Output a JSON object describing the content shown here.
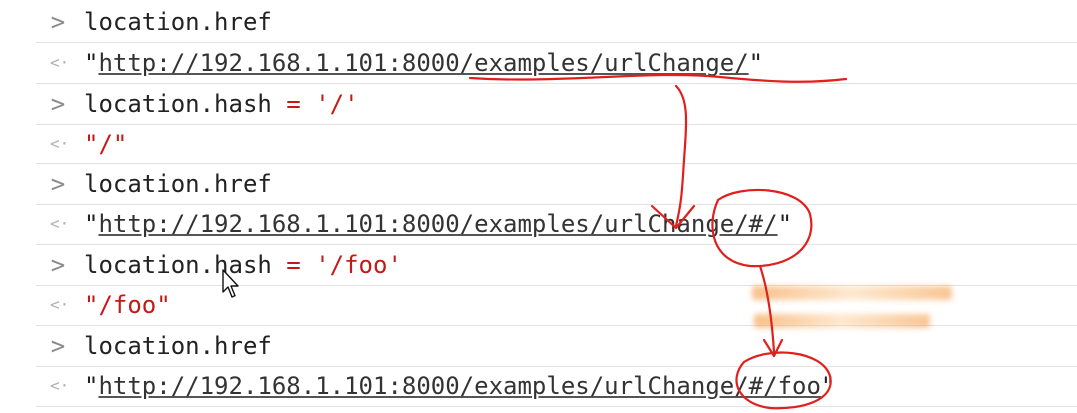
{
  "console": {
    "entries": [
      {
        "type": "input",
        "prompt": ">",
        "text": "location.href"
      },
      {
        "type": "output",
        "prompt": "<·",
        "quote_open": "\"",
        "url": "http://192.168.1.101:8000/examples/urlChange/",
        "quote_close": "\""
      },
      {
        "type": "input",
        "prompt": ">",
        "code": "location.hash",
        "operator": "=",
        "string": "'/'"
      },
      {
        "type": "output",
        "prompt": "<·",
        "value": "\"/\""
      },
      {
        "type": "input",
        "prompt": ">",
        "text": "location.href"
      },
      {
        "type": "output",
        "prompt": "<·",
        "quote_open": "\"",
        "url": "http://192.168.1.101:8000/examples/urlChange/#/",
        "quote_close": "\""
      },
      {
        "type": "input",
        "prompt": ">",
        "code": "location.hash",
        "operator": "=",
        "string": "'/foo'"
      },
      {
        "type": "output",
        "prompt": "<·",
        "value": "\"/foo\""
      },
      {
        "type": "input",
        "prompt": ">",
        "text": "location.href"
      },
      {
        "type": "output",
        "prompt": "<·",
        "quote_open": "\"",
        "url": "http://192.168.1.101:8000/examples/urlChange/#/foo",
        "quote_close": "\""
      }
    ]
  },
  "colors": {
    "annotation": "#e0201c",
    "string_red": "#c41a16",
    "prompt_gray": "#8a8a8a",
    "blurred_note": "#f28c28"
  },
  "icons": {
    "input_prompt": "chevron-right-icon",
    "output_prompt": "return-arrow-icon",
    "cursor": "mouse-pointer-icon"
  }
}
